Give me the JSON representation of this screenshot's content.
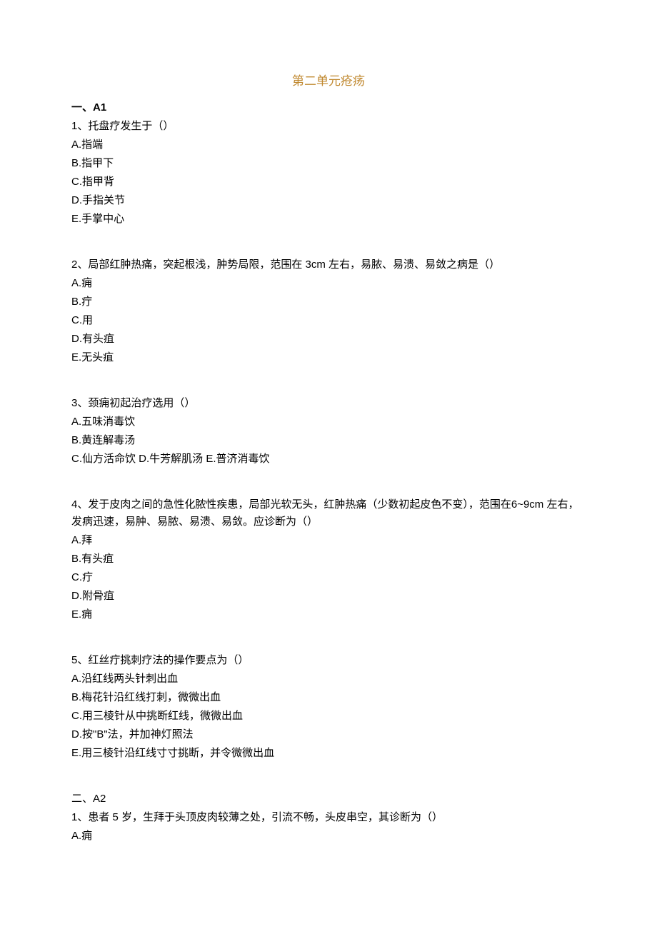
{
  "title": "第二单元疮疡",
  "section_a1": {
    "header": "一、A1",
    "questions": [
      {
        "text": "1、托盘疗发生于（）",
        "options": [
          "A.指端",
          "B.指甲下",
          "C.指甲背",
          "D.手指关节",
          "E.手掌中心"
        ]
      },
      {
        "text": "2、局部红肿热痛，突起根浅，肿势局限，范围在 3cm 左右，易脓、易溃、易敛之病是（）",
        "options": [
          "A.痈",
          "B.疔",
          "C.用",
          "D.有头疽",
          "E.无头疽"
        ]
      },
      {
        "text": "3、颈痈初起治疗选用（）",
        "options": [
          "A.五味消毒饮",
          "B.黄连解毒汤"
        ],
        "inline_options": "C.仙方活命饮 D.牛芳解肌汤 E.普济消毒饮"
      },
      {
        "text": "4、发于皮肉之间的急性化脓性疾患，局部光软无头，红肿热痛（少数初起皮色不变），范围在6~9cm 左右，发病迅速，易肿、易脓、易溃、易敛。应诊断为（）",
        "options": [
          "A.拜",
          "B.有头疽",
          "C.疔",
          "D.附骨疽",
          "E.痈"
        ]
      },
      {
        "text": "5、红丝疔挑刺疗法的操作要点为（）",
        "options": [
          "A.沿红线两头针刺出血",
          "B.梅花针沿红线打刺，微微出血",
          "C.用三棱针从中挑断红线，微微出血",
          "D.按\"B\"法，并加神灯照法",
          "E.用三棱针沿红线寸寸挑断，并令微微出血"
        ]
      }
    ]
  },
  "section_a2": {
    "header": "二、A2",
    "questions": [
      {
        "text": "1、患者 5 岁，生拜于头顶皮肉较薄之处，引流不畅，头皮串空，其诊断为（）",
        "options": [
          "A.痈"
        ]
      }
    ]
  }
}
